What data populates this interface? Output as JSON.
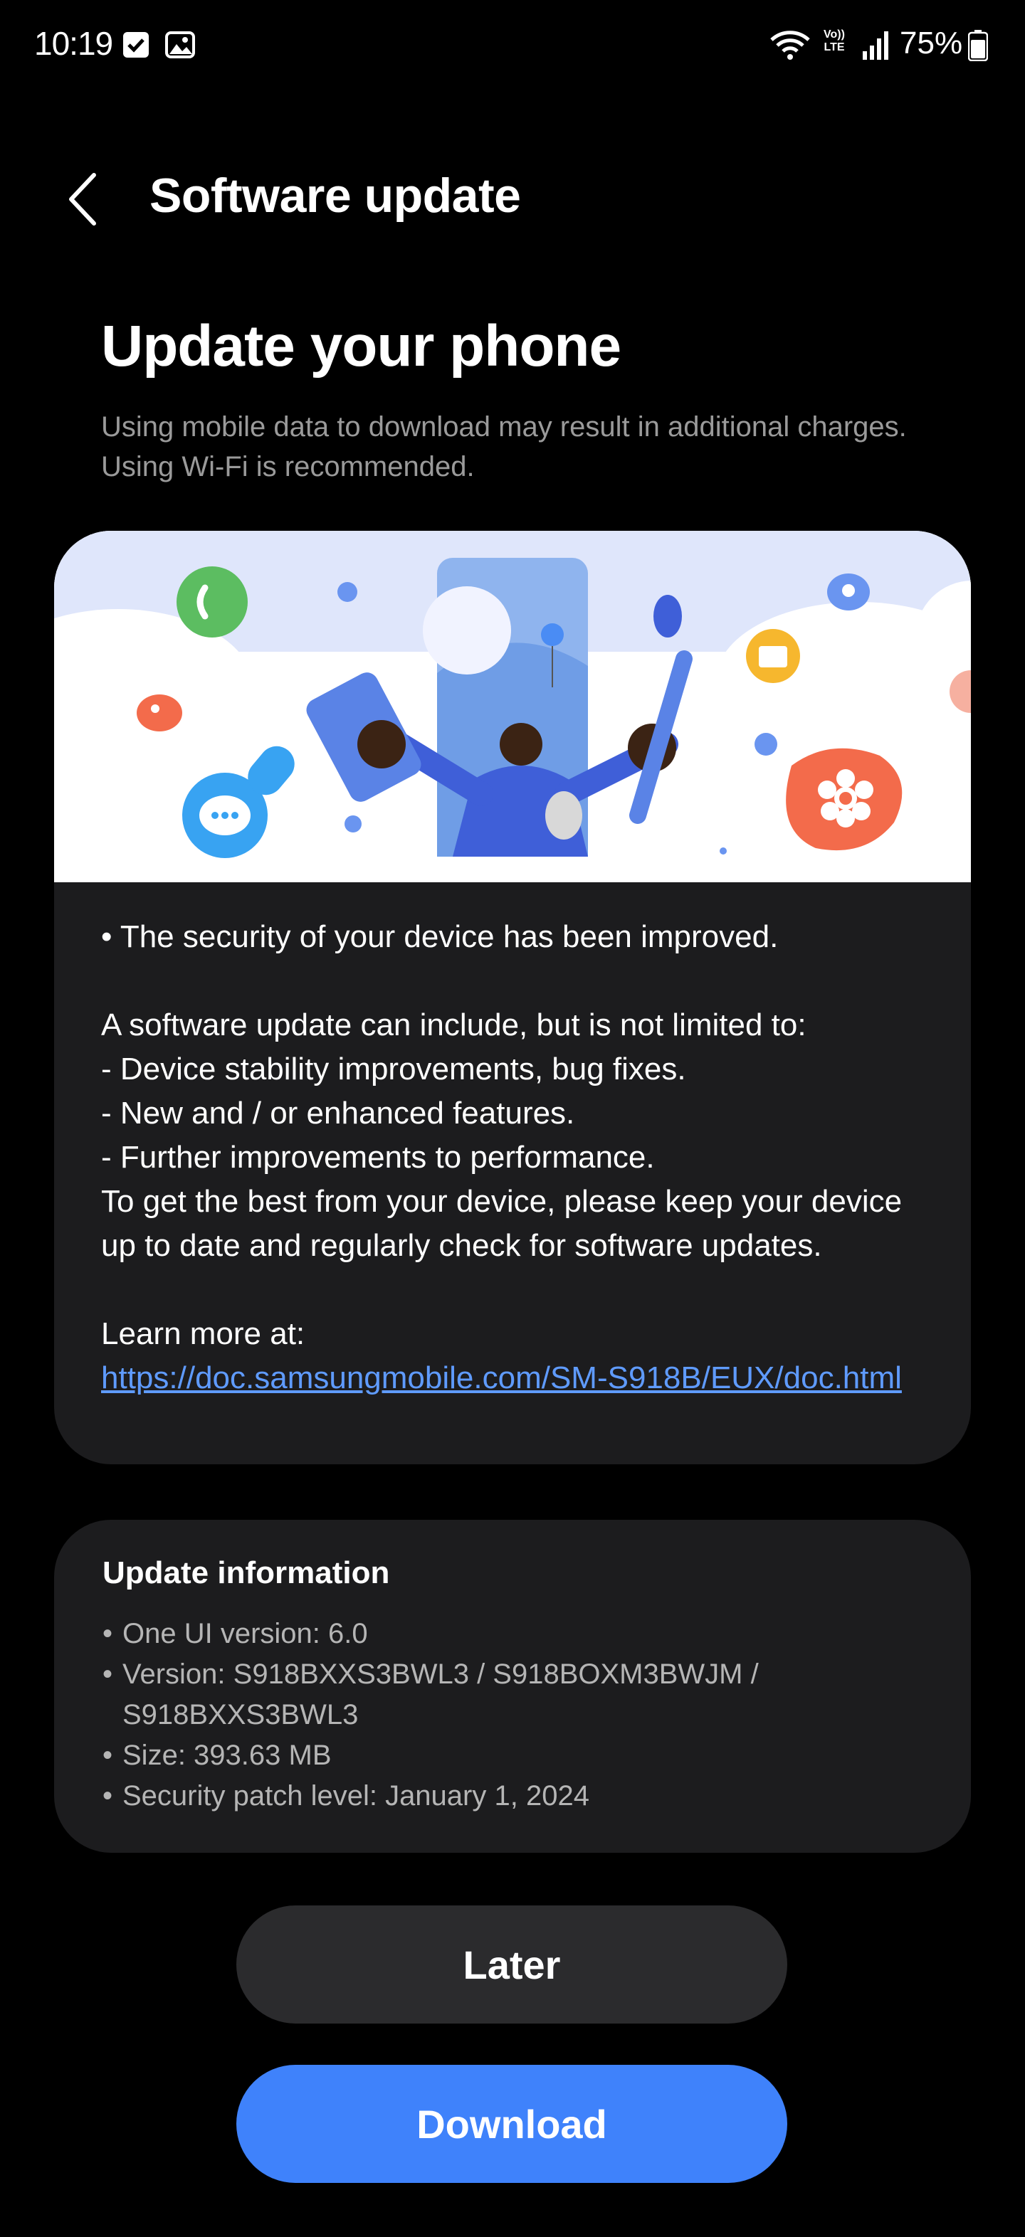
{
  "status_bar": {
    "time": "10:19",
    "battery": "75%",
    "volte_line1": "Vo))",
    "volte_line2": "LTE"
  },
  "header": {
    "title": "Software update"
  },
  "main": {
    "title": "Update your phone",
    "data_note": "Using mobile data to download may result in additional charges.\nUsing Wi-Fi is recommended."
  },
  "release_notes": {
    "body": "• The security of your device has been improved.\n\nA software update can include, but is not limited to:\n - Device stability improvements, bug fixes.\n - New and / or enhanced features.\n - Further improvements to performance.\nTo get the best from your device, please keep your device\nup to date and regularly check for software updates.\n\nLearn more at:",
    "link": "https://doc.samsungmobile.com/SM-S918B/EUX/doc.html"
  },
  "update_info": {
    "title": "Update information",
    "items": [
      "One UI version: 6.0",
      "Version: S918BXXS3BWL3 / S918BOXM3BWJM / S918BXXS3BWL3",
      "Size: 393.63 MB",
      "Security patch level: January 1, 2024"
    ]
  },
  "actions": {
    "later_label": "Later",
    "download_label": "Download"
  },
  "colors": {
    "background": "#000000",
    "card": "#1c1c1e",
    "accent": "#3f82fb",
    "link": "#5f9bff"
  }
}
